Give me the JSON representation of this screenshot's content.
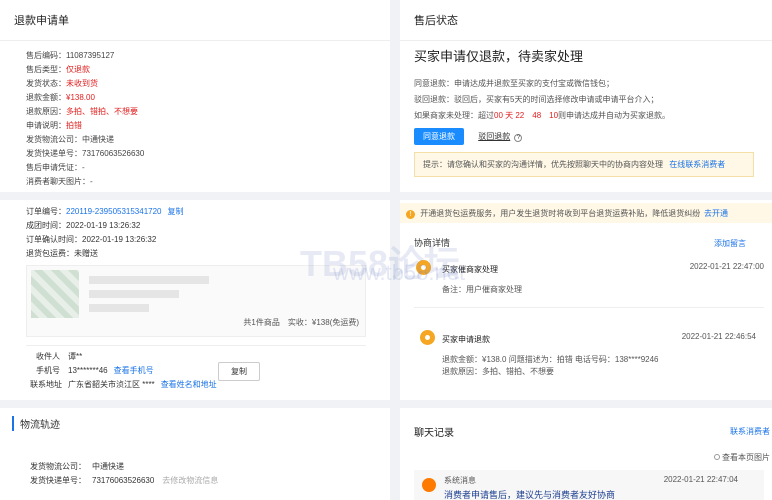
{
  "left": {
    "title": "退款申请单",
    "fields": [
      {
        "label": "售后编码：",
        "value": "11087395127",
        "cls": ""
      },
      {
        "label": "售后类型：",
        "value": "仅退款",
        "cls": "red"
      },
      {
        "label": "发货状态：",
        "value": "未收到货",
        "cls": "red"
      },
      {
        "label": "退款金额：",
        "value": "¥138.00",
        "cls": "red"
      },
      {
        "label": "退款原因：",
        "value": "多拍、错拍、不想要",
        "cls": "red"
      },
      {
        "label": "申请说明：",
        "value": "拍错",
        "cls": "red"
      },
      {
        "label": "发货物流公司：",
        "value": "中通快递",
        "cls": ""
      },
      {
        "label": "发货快递单号：",
        "value": "73176063526630",
        "cls": ""
      },
      {
        "label": "售后申请凭证：",
        "value": "-",
        "cls": ""
      },
      {
        "label": "消费者聊天图片：",
        "value": "-",
        "cls": ""
      }
    ],
    "order": {
      "no_label": "订单编号：",
      "no": "220119-239505315341720",
      "copy": "复制",
      "deal_label": "成团时间：",
      "deal": "2022-01-19 13:26:32",
      "paid_label": "订单确认时间：",
      "paid": "2022-01-19 13:26:32",
      "ins_label": "退货包运费：",
      "ins": "未赠送"
    },
    "goods_summary": "共1件商品　实收：¥138(免运费)",
    "receiver": {
      "name_label": "收件人",
      "name": "谭**",
      "phone_label": "手机号",
      "phone": "13*******46",
      "phone_link": "查看手机号",
      "addr_label": "联系地址",
      "addr": "广东省韶关市浈江区 ****",
      "addr_link": "查看姓名和地址",
      "copy_btn": "复制"
    },
    "logistics": {
      "title": "物流轨迹",
      "company_label": "发货物流公司：",
      "company": "中通快递",
      "no_label": "发货快递单号：",
      "no": "73176063526630",
      "hint": "去修改物流信息"
    }
  },
  "right": {
    "title": "售后状态",
    "headline": "买家申请仅退款，待卖家处理",
    "lines": [
      "同意退款：申请达成并退款至买家的支付宝或微信钱包；",
      "驳回退款：驳回后，买家有5天的时间选择修改申请或申请平台介入；"
    ],
    "countdown_prefix": "如果商家未处理：超过",
    "countdown": "00 天 22　48　10",
    "countdown_suffix": "则申请达成并自动为买家退款。",
    "agree_btn": "同意退款",
    "reject_btn": "驳回退款",
    "tip": "提示：请您确认和买家的沟通详情，优先按照聊天中的协商内容处理",
    "tip_link": "在线联系消费者",
    "banner": "开通退货包运费服务，用户发生退货时将收到平台退货运费补贴，降低退货纠纷",
    "banner_link": "去开通",
    "negotiation_title": "协商详情",
    "add_msg": "添加留言",
    "events": [
      {
        "title": "买家催商家处理",
        "time": "2022-01-21 22:47:00",
        "body": [
          "备注：用户催商家处理"
        ]
      },
      {
        "title": "买家申请退款",
        "time": "2022-01-21 22:46:54",
        "body": [
          "退款金额：¥138.0 问题描述为：拍错 电话号码：138****9246",
          "退款原因：多拍、错拍、不想要"
        ]
      }
    ],
    "chat_title": "聊天记录",
    "chat_link": "联系消费者",
    "chat_toggle": "查看本页图片",
    "chat_msg_sender": "系统消息",
    "chat_msg_time": "2022-01-21 22:47:04",
    "chat_msg_text": "消费者申请售后，建议先与消费者友好协商"
  },
  "watermark": {
    "main": "TB58论坛",
    "sub": "www.tb58.net"
  }
}
